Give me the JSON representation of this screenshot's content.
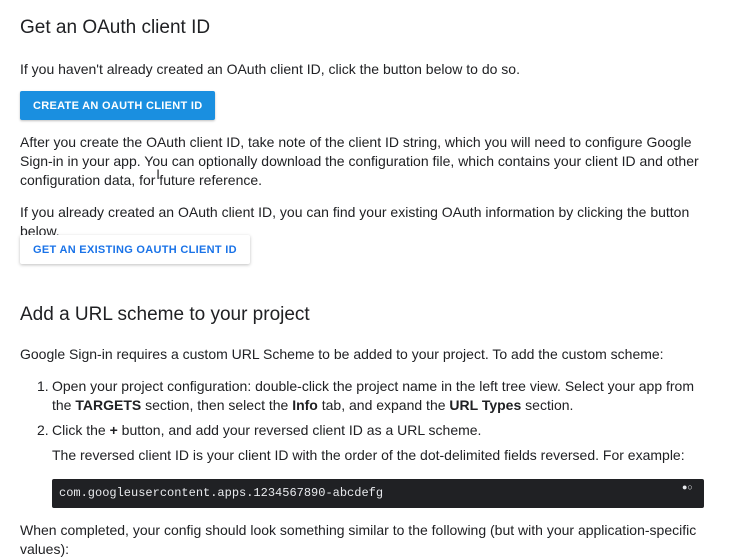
{
  "section1": {
    "title": "Get an OAuth client ID",
    "intro": "If you haven't already created an OAuth client ID, click the button below to do so.",
    "create_button": "CREATE AN OAUTH CLIENT ID",
    "after_part1": "After you create the OAuth client ID, take note of the client ID string, which you will need to configure Google Sign-in in your app. Yo",
    "after_part2": "u can optionally download the configuration file, which contains your client ID and other configuration data, for future reference.",
    "existing_text": "If you already created an OAuth client ID, you can find your existing OAuth information by clicking the button below.",
    "existing_button": "GET AN EXISTING OAUTH CLIENT ID"
  },
  "section2": {
    "title": "Add a URL scheme to your project",
    "intro": "Google Sign-in requires a custom URL Scheme to be added to your project. To add the custom scheme:",
    "steps": [
      {
        "num": "1.",
        "t1": "Open your project configuration: double-click the project name in the left tree view. Select your app from the ",
        "b1": "TARGETS",
        "t2": " section, then select the ",
        "b2": "Info",
        "t3": " tab, and expand the ",
        "b3": "URL Types",
        "t4": " section."
      },
      {
        "num": "2.",
        "t1": "Click the ",
        "b1": "+",
        "t2": " button, and add your reversed client ID as a URL scheme.",
        "sub": "The reversed client ID is your client ID with the order of the dot-delimited fields reversed. For example:"
      }
    ],
    "code": "com.googleusercontent.apps.1234567890-abcdefg",
    "code_toggle_icon": "dark-mode-toggle-icon",
    "completed_text": "When completed, your config should look something similar to the following (but with your application-specific values):"
  }
}
